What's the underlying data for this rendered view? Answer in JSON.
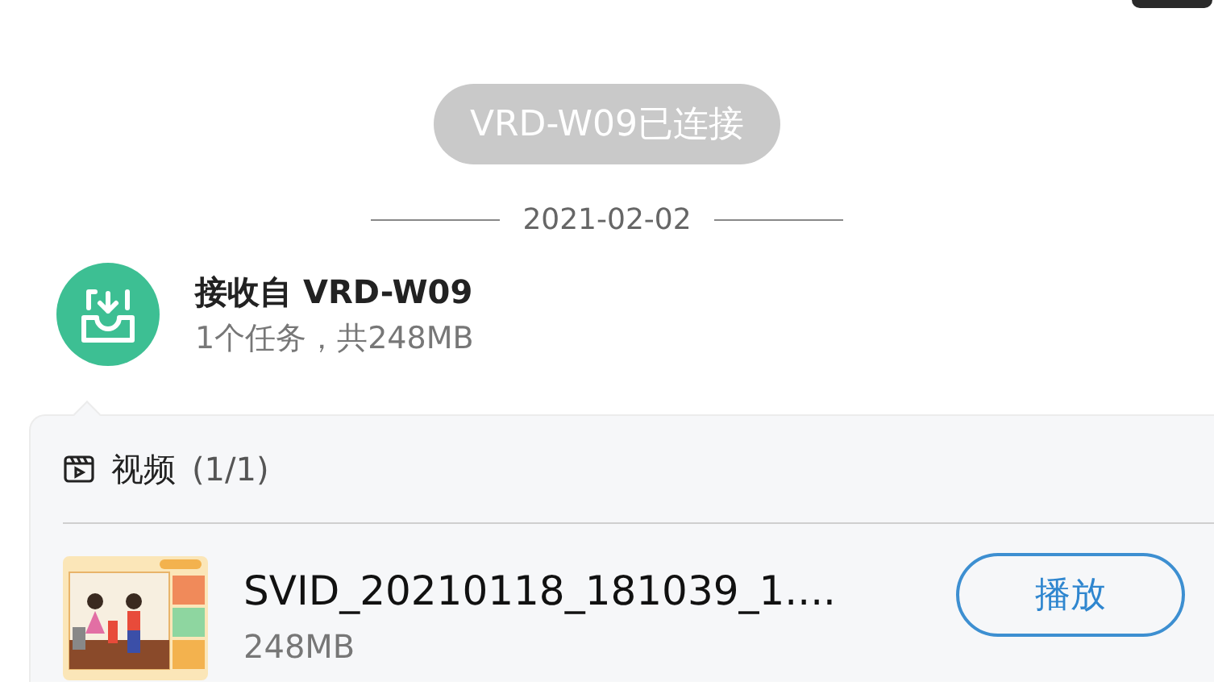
{
  "status_toast": "VRD-W09已连接",
  "date_separator": "2021-02-02",
  "transfer": {
    "title": "接收自 VRD-W09",
    "summary": "1个任务，共248MB",
    "section": {
      "label": "视频",
      "count": "(1/1)"
    },
    "files": [
      {
        "name": "SVID_20210118_181039_1....",
        "size": "248MB",
        "action": "播放"
      }
    ]
  }
}
